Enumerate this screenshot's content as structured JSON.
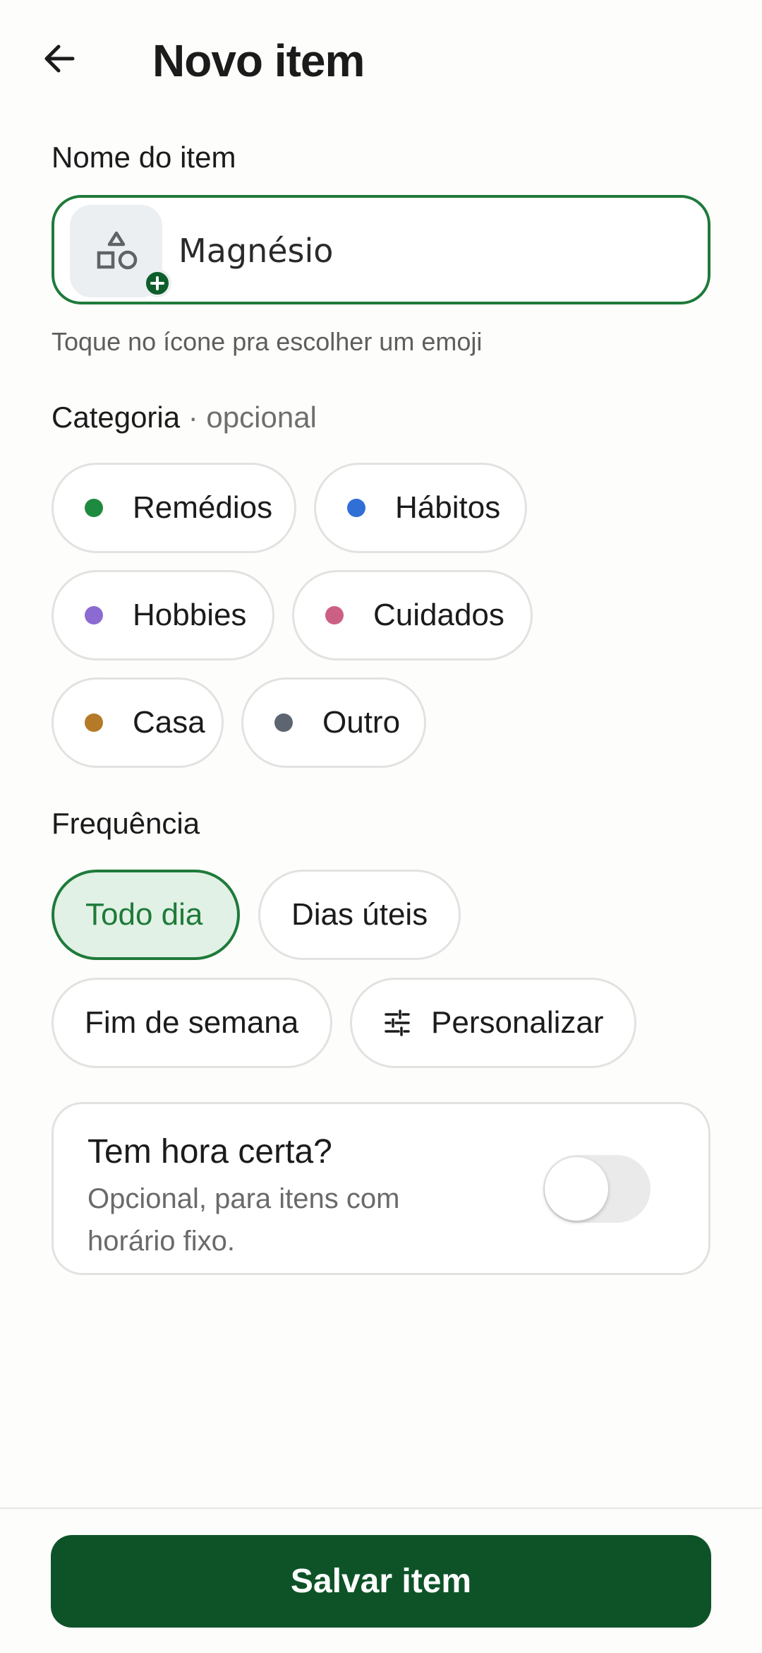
{
  "header": {
    "title": "Novo item",
    "back_icon": "arrow-left-icon"
  },
  "name_section": {
    "label": "Nome do item",
    "value": "Magnésio",
    "hint": "Toque no ícone pra escolher um emoji",
    "emoji_icon": "shapes-icon",
    "badge_icon": "plus-icon"
  },
  "category": {
    "label": "Categoria",
    "optional": "· opcional",
    "options": [
      {
        "label": "Remédios",
        "color": "#1E8A3F"
      },
      {
        "label": "Hábitos",
        "color": "#2F6FD6"
      },
      {
        "label": "Hobbies",
        "color": "#8B6BD1"
      },
      {
        "label": "Cuidados",
        "color": "#CC5F84"
      },
      {
        "label": "Casa",
        "color": "#B57A28"
      },
      {
        "label": "Outro",
        "color": "#5D6670"
      }
    ]
  },
  "frequency": {
    "label": "Frequência",
    "options": [
      {
        "label": "Todo dia",
        "selected": true
      },
      {
        "label": "Dias úteis",
        "selected": false
      },
      {
        "label": "Fim de semana",
        "selected": false
      },
      {
        "label": "Personalizar",
        "selected": false,
        "icon": "tune-icon"
      }
    ]
  },
  "time": {
    "title": "Tem hora certa?",
    "subtitle": "Opcional, para itens com horário fixo.",
    "enabled": false
  },
  "footer": {
    "save_label": "Salvar item"
  },
  "colors": {
    "accent": "#1F7A3A",
    "accent_dark": "#0E5328",
    "selected_bg": "#E1F1E5",
    "background": "#FDFDFB"
  }
}
